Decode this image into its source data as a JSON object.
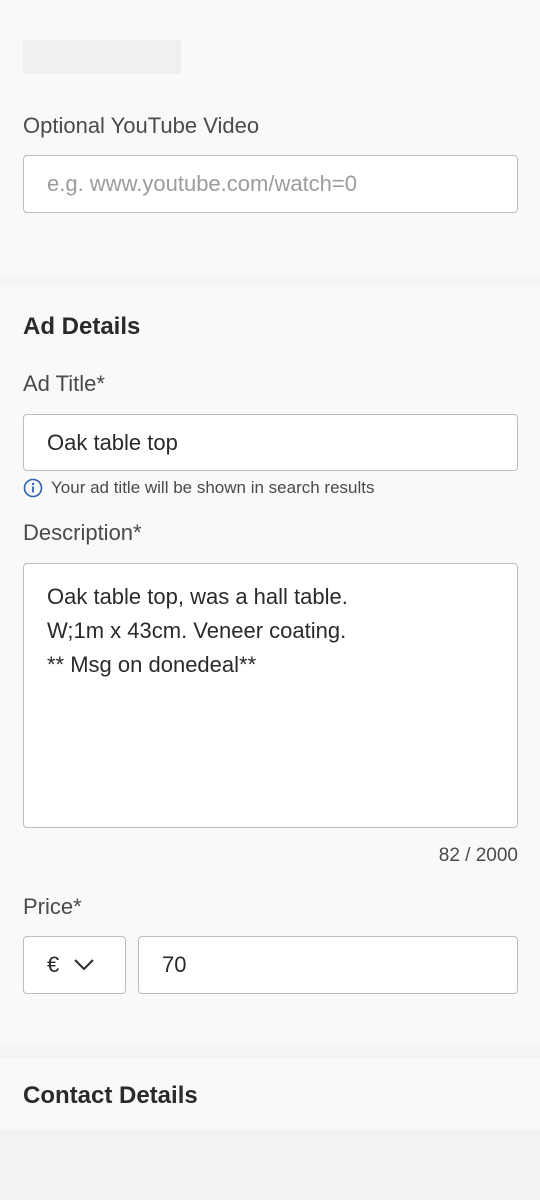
{
  "media": {
    "youtube_label": "Optional YouTube Video",
    "youtube_placeholder": "e.g. www.youtube.com/watch=0"
  },
  "ad_details": {
    "heading": "Ad Details",
    "title_label": "Ad Title*",
    "title_value": "Oak table top",
    "title_hint": "Your ad title will be shown in search results",
    "description_label": "Description*",
    "description_value": "Oak table top, was a hall table.\nW;1m x 43cm. Veneer coating.\n** Msg on donedeal**",
    "char_count": "82 / 2000",
    "price_label": "Price*",
    "currency": "€",
    "price_value": "70"
  },
  "contact": {
    "heading": "Contact Details"
  },
  "icons": {
    "info": "info-icon",
    "chevron": "chevron-down-icon"
  },
  "colors": {
    "info_blue": "#2f5fb3",
    "border": "#bdbdbd"
  }
}
